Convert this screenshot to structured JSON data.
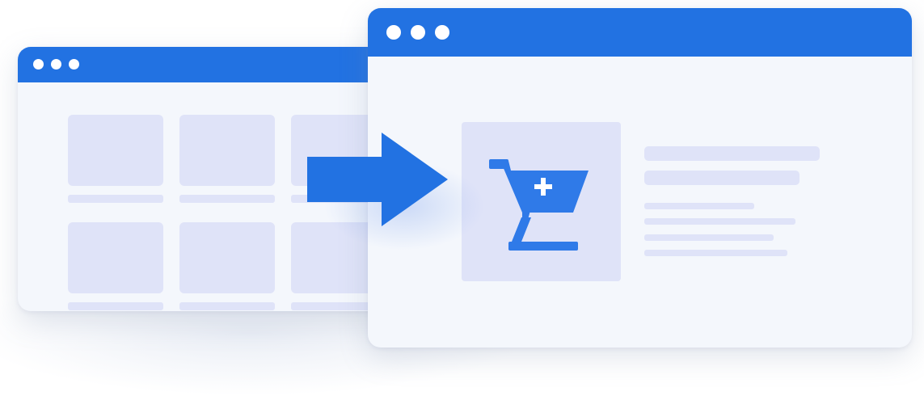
{
  "colors": {
    "accent": "#2272e2",
    "placeholder": "#dfe3f8",
    "window_background": "#f4f7fc",
    "cart_blue": "#2f7ae8"
  },
  "back_window": {
    "window_controls": [
      "dot",
      "dot",
      "dot"
    ],
    "product_grid": {
      "rows": 2,
      "columns": 3
    }
  },
  "transition_arrow": {
    "icon": "arrow-right-icon",
    "direction": "right"
  },
  "front_window": {
    "window_controls": [
      "dot",
      "dot",
      "dot"
    ],
    "product_image": {
      "icon": "add-to-cart-icon"
    },
    "detail_lines": 6
  }
}
